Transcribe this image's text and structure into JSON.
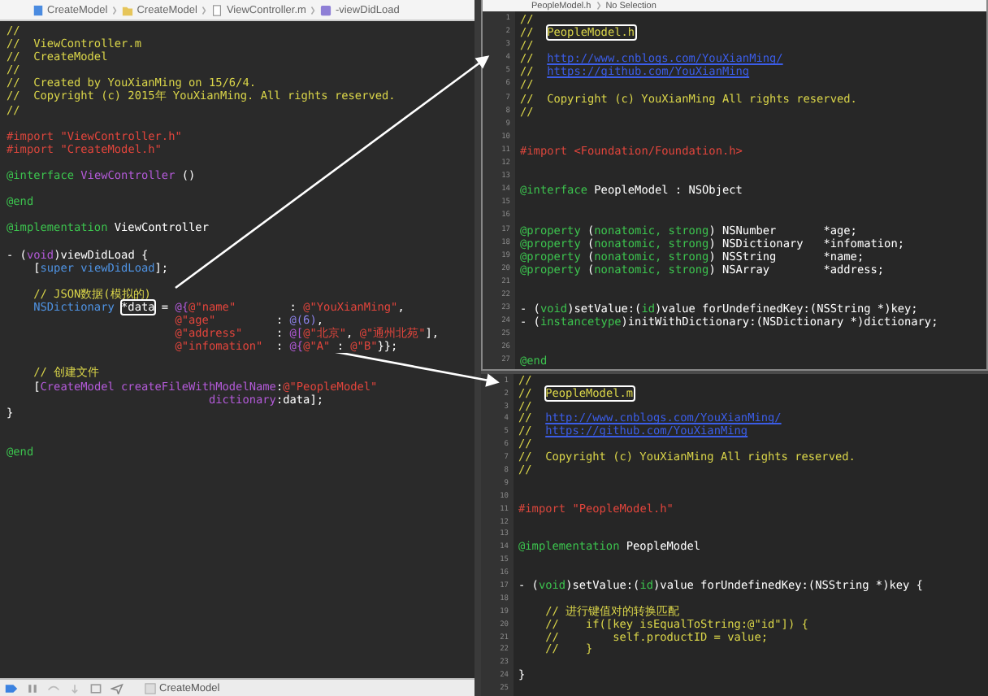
{
  "left_editor": {
    "breadcrumb": [
      {
        "label": "CreateModel",
        "kind": "project"
      },
      {
        "label": "CreateModel",
        "kind": "folder"
      },
      {
        "label": "ViewController.m",
        "kind": "file"
      },
      {
        "label": "-viewDidLoad",
        "kind": "method"
      }
    ],
    "lines": [
      {
        "kind": "code",
        "tokens": [
          {
            "text": "//",
            "kind": "c"
          }
        ]
      },
      {
        "kind": "code",
        "tokens": [
          {
            "text": "//  ViewController.m",
            "kind": "c"
          }
        ]
      },
      {
        "kind": "code",
        "tokens": [
          {
            "text": "//  CreateModel",
            "kind": "c"
          }
        ]
      },
      {
        "kind": "code",
        "tokens": [
          {
            "text": "//",
            "kind": "c"
          }
        ]
      },
      {
        "kind": "code",
        "tokens": [
          {
            "text": "//  Created by YouXianMing on 15/6/4.",
            "kind": "c"
          }
        ]
      },
      {
        "kind": "code",
        "tokens": [
          {
            "text": "//  Copyright (c) 2015年 YouXianMing. All rights reserved.",
            "kind": "c"
          }
        ]
      },
      {
        "kind": "code",
        "tokens": [
          {
            "text": "//",
            "kind": "c"
          }
        ]
      },
      {
        "kind": "blank"
      },
      {
        "kind": "code",
        "tokens": [
          {
            "text": "#import ",
            "kind": "p"
          },
          {
            "text": "\"ViewController.h\"",
            "kind": "s"
          }
        ]
      },
      {
        "kind": "code",
        "tokens": [
          {
            "text": "#import ",
            "kind": "p"
          },
          {
            "text": "\"CreateModel.h\"",
            "kind": "s"
          }
        ]
      },
      {
        "kind": "blank"
      },
      {
        "kind": "code",
        "tokens": [
          {
            "text": "@interface",
            "kind": "k"
          },
          {
            "text": " ViewController",
            "kind": "m"
          },
          {
            "text": " ()",
            "kind": "x"
          }
        ]
      },
      {
        "kind": "blank"
      },
      {
        "kind": "code",
        "tokens": [
          {
            "text": "@end",
            "kind": "k"
          }
        ]
      },
      {
        "kind": "blank"
      },
      {
        "kind": "code",
        "tokens": [
          {
            "text": "@implementation",
            "kind": "k"
          },
          {
            "text": " ViewController",
            "kind": "x"
          }
        ]
      },
      {
        "kind": "blank"
      },
      {
        "kind": "code",
        "tokens": [
          {
            "text": "- (",
            "kind": "x"
          },
          {
            "text": "void",
            "kind": "m"
          },
          {
            "text": ")viewDidLoad {",
            "kind": "x"
          }
        ]
      },
      {
        "kind": "code",
        "tokens": [
          {
            "text": "    [",
            "kind": "x"
          },
          {
            "text": "super viewDidLoad",
            "kind": "t"
          },
          {
            "text": "];",
            "kind": "x"
          }
        ]
      },
      {
        "kind": "blank"
      },
      {
        "kind": "code",
        "tokens": [
          {
            "text": "    // JSON数据(模拟的)",
            "kind": "c"
          }
        ]
      },
      {
        "kind": "code",
        "tokens": [
          {
            "text": "    NSDictionary ",
            "kind": "t"
          },
          {
            "text": "*data",
            "kind": "x",
            "boxed": true
          },
          {
            "text": " = ",
            "kind": "x"
          },
          {
            "text": "@{",
            "kind": "m"
          },
          {
            "text": "@\"name\"",
            "kind": "s"
          },
          {
            "text": "        : ",
            "kind": "x"
          },
          {
            "text": "@\"YouXianMing\"",
            "kind": "s"
          },
          {
            "text": ",",
            "kind": "x"
          }
        ]
      },
      {
        "kind": "code",
        "tokens": [
          {
            "text": "                         @\"age\"",
            "kind": "s"
          },
          {
            "text": "         : ",
            "kind": "x"
          },
          {
            "text": "@(6)",
            "kind": "n"
          },
          {
            "text": ",",
            "kind": "x"
          }
        ]
      },
      {
        "kind": "code",
        "tokens": [
          {
            "text": "                         @\"address\"",
            "kind": "s"
          },
          {
            "text": "     : ",
            "kind": "x"
          },
          {
            "text": "@[",
            "kind": "m"
          },
          {
            "text": "@\"北京\"",
            "kind": "s"
          },
          {
            "text": ", ",
            "kind": "x"
          },
          {
            "text": "@\"通州北苑\"",
            "kind": "s"
          },
          {
            "text": "],",
            "kind": "x"
          }
        ]
      },
      {
        "kind": "code",
        "tokens": [
          {
            "text": "                         @\"infomation\"",
            "kind": "s"
          },
          {
            "text": "  : ",
            "kind": "x"
          },
          {
            "text": "@{",
            "kind": "m"
          },
          {
            "text": "@\"A\"",
            "kind": "s"
          },
          {
            "text": " : ",
            "kind": "x"
          },
          {
            "text": "@\"B\"",
            "kind": "s"
          },
          {
            "text": "}};",
            "kind": "x"
          }
        ]
      },
      {
        "kind": "blank"
      },
      {
        "kind": "code",
        "tokens": [
          {
            "text": "    // 创建文件",
            "kind": "c"
          }
        ]
      },
      {
        "kind": "code",
        "tokens": [
          {
            "text": "    [",
            "kind": "x"
          },
          {
            "text": "CreateModel createFileWithModelName",
            "kind": "m"
          },
          {
            "text": ":",
            "kind": "x"
          },
          {
            "text": "@\"PeopleModel\"",
            "kind": "s"
          }
        ]
      },
      {
        "kind": "code",
        "tokens": [
          {
            "text": "                              dictionary",
            "kind": "m"
          },
          {
            "text": ":data];",
            "kind": "x"
          }
        ]
      },
      {
        "kind": "code",
        "tokens": [
          {
            "text": "}",
            "kind": "x"
          }
        ]
      },
      {
        "kind": "blank"
      },
      {
        "kind": "blank"
      },
      {
        "kind": "code",
        "tokens": [
          {
            "text": "@end",
            "kind": "k"
          }
        ]
      }
    ]
  },
  "debug_bar": {
    "target": "CreateModel"
  },
  "header_editor": {
    "breadcrumb": [
      {
        "label": "PeopleModel.h"
      },
      {
        "label": "No Selection"
      }
    ],
    "lines": [
      {
        "n": "1",
        "tokens": [
          {
            "text": "//",
            "kind": "c"
          }
        ]
      },
      {
        "n": "2",
        "tokens": [
          {
            "text": "//  ",
            "kind": "c"
          },
          {
            "text": "PeopleModel.h",
            "kind": "c",
            "boxed": true
          }
        ]
      },
      {
        "n": "3",
        "tokens": [
          {
            "text": "//",
            "kind": "c"
          }
        ]
      },
      {
        "n": "4",
        "tokens": [
          {
            "text": "//  ",
            "kind": "c"
          },
          {
            "text": "http://www.cnblogs.com/YouXianMing/",
            "kind": "l"
          }
        ]
      },
      {
        "n": "5",
        "tokens": [
          {
            "text": "//  ",
            "kind": "c"
          },
          {
            "text": "https://github.com/YouXianMing",
            "kind": "l"
          }
        ]
      },
      {
        "n": "6",
        "tokens": [
          {
            "text": "//",
            "kind": "c"
          }
        ]
      },
      {
        "n": "7",
        "tokens": [
          {
            "text": "//  Copyright (c) YouXianMing All rights reserved.",
            "kind": "c"
          }
        ]
      },
      {
        "n": "8",
        "tokens": [
          {
            "text": "//",
            "kind": "c"
          }
        ]
      },
      {
        "n": "9"
      },
      {
        "n": "10"
      },
      {
        "n": "11",
        "tokens": [
          {
            "text": "#import ",
            "kind": "p"
          },
          {
            "text": "<Foundation/Foundation.h>",
            "kind": "s"
          }
        ]
      },
      {
        "n": "12"
      },
      {
        "n": "13"
      },
      {
        "n": "14",
        "tokens": [
          {
            "text": "@interface",
            "kind": "k"
          },
          {
            "text": " PeopleModel : NSObject",
            "kind": "x"
          }
        ]
      },
      {
        "n": "15"
      },
      {
        "n": "16"
      },
      {
        "n": "17",
        "tokens": [
          {
            "text": "@property",
            "kind": "k"
          },
          {
            "text": " (",
            "kind": "x"
          },
          {
            "text": "nonatomic, strong",
            "kind": "k"
          },
          {
            "text": ") NSNumber       *age;",
            "kind": "x"
          }
        ]
      },
      {
        "n": "18",
        "tokens": [
          {
            "text": "@property",
            "kind": "k"
          },
          {
            "text": " (",
            "kind": "x"
          },
          {
            "text": "nonatomic, strong",
            "kind": "k"
          },
          {
            "text": ") NSDictionary   *infomation;",
            "kind": "x"
          }
        ]
      },
      {
        "n": "19",
        "tokens": [
          {
            "text": "@property",
            "kind": "k"
          },
          {
            "text": " (",
            "kind": "x"
          },
          {
            "text": "nonatomic, strong",
            "kind": "k"
          },
          {
            "text": ") NSString       *name;",
            "kind": "x"
          }
        ]
      },
      {
        "n": "20",
        "tokens": [
          {
            "text": "@property",
            "kind": "k"
          },
          {
            "text": " (",
            "kind": "x"
          },
          {
            "text": "nonatomic, strong",
            "kind": "k"
          },
          {
            "text": ") NSArray        *address;",
            "kind": "x"
          }
        ]
      },
      {
        "n": "21"
      },
      {
        "n": "22"
      },
      {
        "n": "23",
        "tokens": [
          {
            "text": "- (",
            "kind": "x"
          },
          {
            "text": "void",
            "kind": "k"
          },
          {
            "text": ")setValue:(",
            "kind": "x"
          },
          {
            "text": "id",
            "kind": "k"
          },
          {
            "text": ")value forUndefinedKey:(NSString *)key;",
            "kind": "x"
          }
        ]
      },
      {
        "n": "24",
        "tokens": [
          {
            "text": "- (",
            "kind": "x"
          },
          {
            "text": "instancetype",
            "kind": "k"
          },
          {
            "text": ")initWithDictionary:(NSDictionary *)dictionary;",
            "kind": "x"
          }
        ]
      },
      {
        "n": "25"
      },
      {
        "n": "26"
      },
      {
        "n": "27",
        "tokens": [
          {
            "text": "@end",
            "kind": "k"
          }
        ]
      }
    ]
  },
  "implementation_editor": {
    "lines": [
      {
        "n": "1",
        "tokens": [
          {
            "text": "//",
            "kind": "c"
          }
        ]
      },
      {
        "n": "2",
        "tokens": [
          {
            "text": "//  ",
            "kind": "c"
          },
          {
            "text": "PeopleModel.m",
            "kind": "c",
            "boxed": true
          }
        ]
      },
      {
        "n": "3",
        "tokens": [
          {
            "text": "//",
            "kind": "c"
          }
        ]
      },
      {
        "n": "4",
        "tokens": [
          {
            "text": "//  ",
            "kind": "c"
          },
          {
            "text": "http://www.cnblogs.com/YouXianMing/",
            "kind": "l"
          }
        ]
      },
      {
        "n": "5",
        "tokens": [
          {
            "text": "//  ",
            "kind": "c"
          },
          {
            "text": "https://github.com/YouXianMing",
            "kind": "l"
          }
        ]
      },
      {
        "n": "6",
        "tokens": [
          {
            "text": "//",
            "kind": "c"
          }
        ]
      },
      {
        "n": "7",
        "tokens": [
          {
            "text": "//  Copyright (c) YouXianMing All rights reserved.",
            "kind": "c"
          }
        ]
      },
      {
        "n": "8",
        "tokens": [
          {
            "text": "//",
            "kind": "c"
          }
        ]
      },
      {
        "n": "9"
      },
      {
        "n": "10"
      },
      {
        "n": "11",
        "tokens": [
          {
            "text": "#import ",
            "kind": "p"
          },
          {
            "text": "\"PeopleModel.h\"",
            "kind": "s"
          }
        ]
      },
      {
        "n": "12"
      },
      {
        "n": "13"
      },
      {
        "n": "14",
        "tokens": [
          {
            "text": "@implementation",
            "kind": "k"
          },
          {
            "text": " PeopleModel",
            "kind": "x"
          }
        ]
      },
      {
        "n": "15"
      },
      {
        "n": "16"
      },
      {
        "n": "17",
        "tokens": [
          {
            "text": "- (",
            "kind": "x"
          },
          {
            "text": "void",
            "kind": "k"
          },
          {
            "text": ")setValue:(",
            "kind": "x"
          },
          {
            "text": "id",
            "kind": "k"
          },
          {
            "text": ")value forUndefinedKey:(NSString *)key {",
            "kind": "x"
          }
        ]
      },
      {
        "n": "18"
      },
      {
        "n": "19",
        "tokens": [
          {
            "text": "    // 进行键值对的转换匹配",
            "kind": "c"
          }
        ]
      },
      {
        "n": "20",
        "tokens": [
          {
            "text": "    //    if([key isEqualToString:@\"id\"]) {",
            "kind": "c"
          }
        ]
      },
      {
        "n": "21",
        "tokens": [
          {
            "text": "    //        self.productID = value;",
            "kind": "c"
          }
        ]
      },
      {
        "n": "22",
        "tokens": [
          {
            "text": "    //    }",
            "kind": "c"
          }
        ]
      },
      {
        "n": "23"
      },
      {
        "n": "24",
        "tokens": [
          {
            "text": "}",
            "kind": "x"
          }
        ]
      },
      {
        "n": "25"
      }
    ]
  }
}
